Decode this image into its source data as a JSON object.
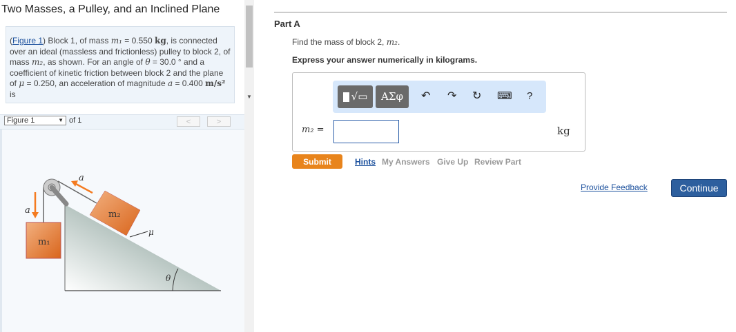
{
  "title": "Two Masses, a Pulley, and an Inclined Plane",
  "problem": {
    "figure_link": "Figure 1",
    "parts": [
      "Block 1, of mass ",
      "m₁",
      " = 0.550 ",
      "kg",
      ", is connected over an ideal (massless and frictionless) pulley to block 2, of mass ",
      "m₂",
      ", as shown. For an angle of ",
      "θ",
      " = 30.0 ° and a coefficient of kinetic friction between block 2 and the plane of ",
      "μ",
      " = 0.250, an acceleration of magnitude ",
      "a",
      " = 0.400 ",
      "m/s²",
      " is"
    ]
  },
  "figure_nav": {
    "selected": "Figure 1",
    "of": "of 1",
    "prev": "<",
    "next": ">"
  },
  "figure": {
    "m1": "m₁",
    "m2": "m₂",
    "a": "a",
    "mu": "μ",
    "theta": "θ",
    "accent": "#f47b20"
  },
  "part": {
    "label": "Part A",
    "question": "Find the mass of block 2, ",
    "question_var": "m₂",
    "question_end": ".",
    "instruction": "Express your answer numerically in kilograms."
  },
  "toolbar": {
    "templates": "√",
    "symbols": "ΑΣφ",
    "undo": "↶",
    "redo": "↷",
    "reset": "↻",
    "keyboard": "⌨",
    "help": "?"
  },
  "answer": {
    "label": "m₂ =",
    "value": "",
    "unit": "kg"
  },
  "actions": {
    "submit": "Submit",
    "hints": "Hints",
    "my_answers": "My Answers",
    "give_up": "Give Up",
    "review": "Review Part"
  },
  "footer": {
    "feedback": "Provide Feedback",
    "continue": "Continue"
  }
}
